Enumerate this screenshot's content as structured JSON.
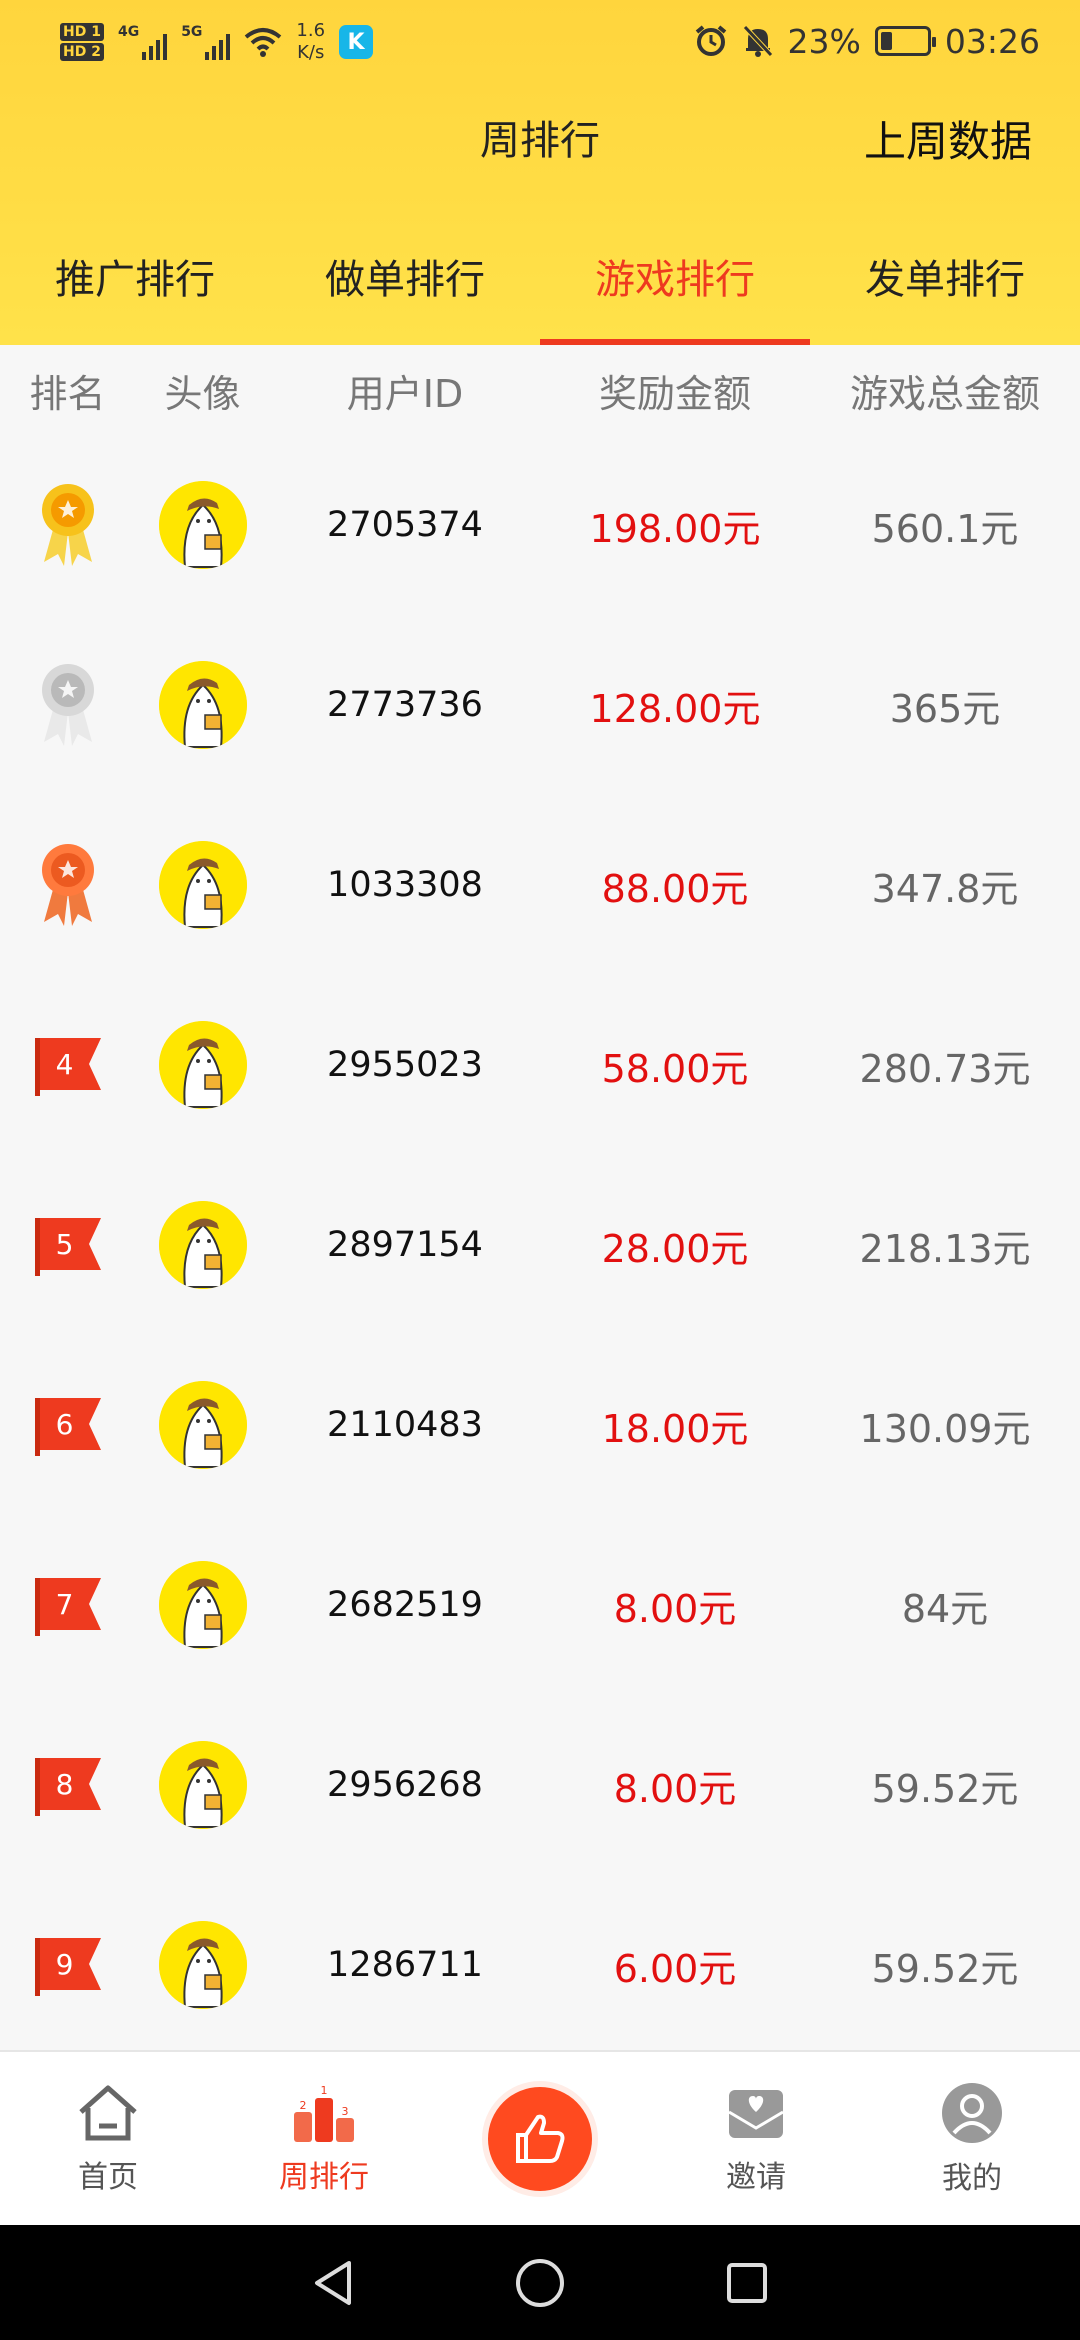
{
  "status": {
    "network_speed": "1.6",
    "network_unit": "K/s",
    "battery": "23%",
    "battery_level": 0.23,
    "time": "03:26",
    "hd1": "HD 1",
    "hd2": "HD 2",
    "net4g": "4G",
    "net5g": "5G",
    "app_badge": "K"
  },
  "header": {
    "title": "周排行",
    "action": "上周数据"
  },
  "tabs": [
    {
      "label": "推广排行"
    },
    {
      "label": "做单排行"
    },
    {
      "label": "游戏排行"
    },
    {
      "label": "发单排行"
    }
  ],
  "columns": [
    "排名",
    "头像",
    "用户ID",
    "奖励金额",
    "游戏总金额"
  ],
  "rows": [
    {
      "rank": "1",
      "uid": "2705374",
      "reward": "198.00元",
      "total": "560.1元"
    },
    {
      "rank": "2",
      "uid": "2773736",
      "reward": "128.00元",
      "total": "365元"
    },
    {
      "rank": "3",
      "uid": "1033308",
      "reward": "88.00元",
      "total": "347.8元"
    },
    {
      "rank": "4",
      "uid": "2955023",
      "reward": "58.00元",
      "total": "280.73元"
    },
    {
      "rank": "5",
      "uid": "2897154",
      "reward": "28.00元",
      "total": "218.13元"
    },
    {
      "rank": "6",
      "uid": "2110483",
      "reward": "18.00元",
      "total": "130.09元"
    },
    {
      "rank": "7",
      "uid": "2682519",
      "reward": "8.00元",
      "total": "84元"
    },
    {
      "rank": "8",
      "uid": "2956268",
      "reward": "8.00元",
      "total": "59.52元"
    },
    {
      "rank": "9",
      "uid": "1286711",
      "reward": "6.00元",
      "total": "59.52元"
    }
  ],
  "nav": [
    {
      "label": "首页",
      "icon": "home-icon"
    },
    {
      "label": "周排行",
      "icon": "podium-icon"
    },
    {
      "label": "",
      "icon": "thumbs-up-icon"
    },
    {
      "label": "邀请",
      "icon": "invite-envelope-icon"
    },
    {
      "label": "我的",
      "icon": "profile-icon"
    }
  ],
  "colors": {
    "accent": "#ee3a1f",
    "header": "#ffd53d",
    "reward": "#e21010"
  }
}
